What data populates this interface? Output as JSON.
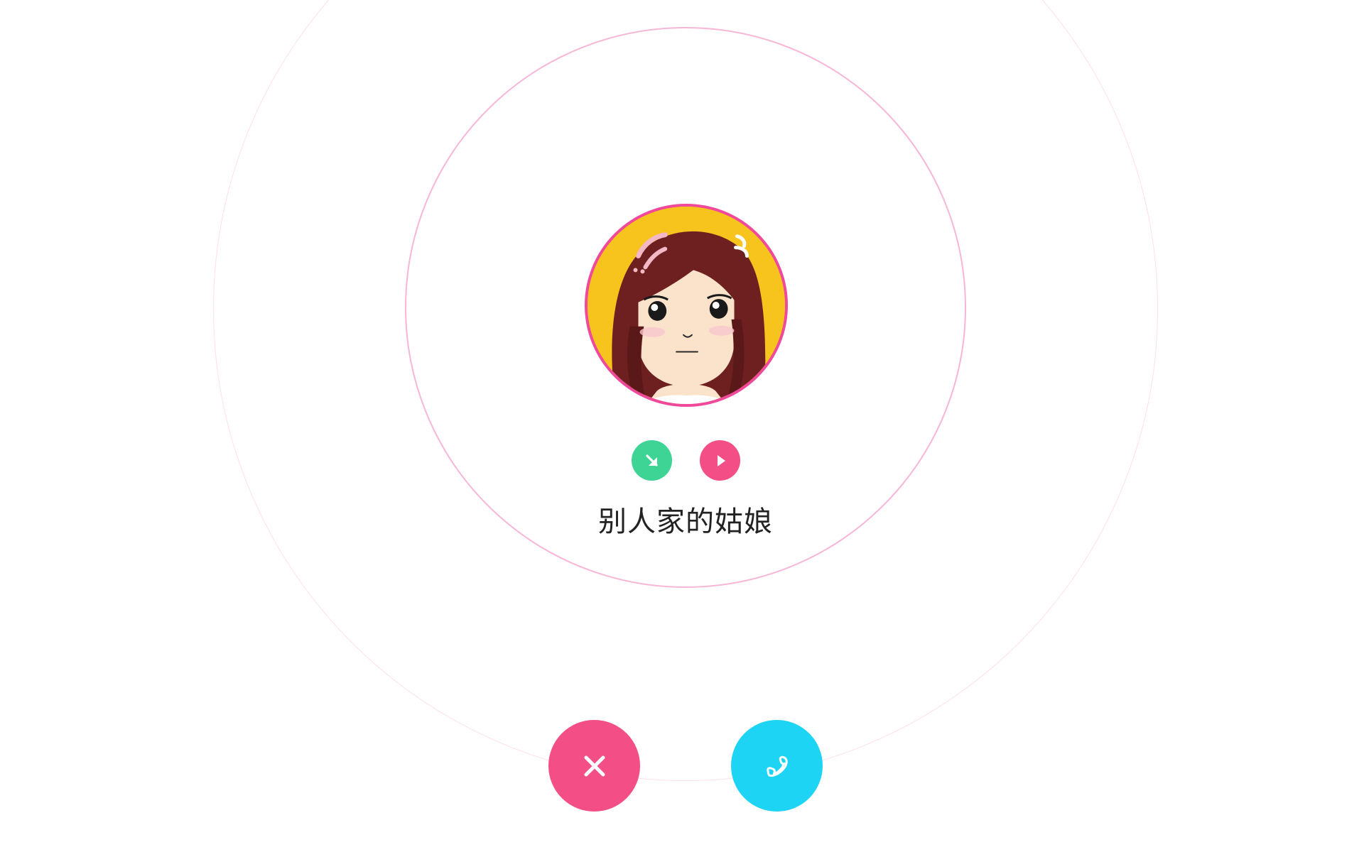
{
  "caller": {
    "name": "别人家的姑娘",
    "avatar_icon": "girl-avatar-icon"
  },
  "colors": {
    "ring_outer": "#fde0ec",
    "ring_inner": "#f8b6d6",
    "avatar_border": "#f0489b",
    "avatar_background": "#f7c31d",
    "incoming_badge": "#3ed495",
    "play_button": "#f34f86",
    "decline_button": "#f34f86",
    "accept_button": "#1ed4f5",
    "name_text": "#222222"
  },
  "status_icons": [
    {
      "icon": "incoming-arrow-icon",
      "color": "#3ed495"
    },
    {
      "icon": "play-icon",
      "color": "#f34f86"
    }
  ],
  "actions": {
    "decline": {
      "icon": "close-icon"
    },
    "accept": {
      "icon": "phone-icon"
    }
  }
}
